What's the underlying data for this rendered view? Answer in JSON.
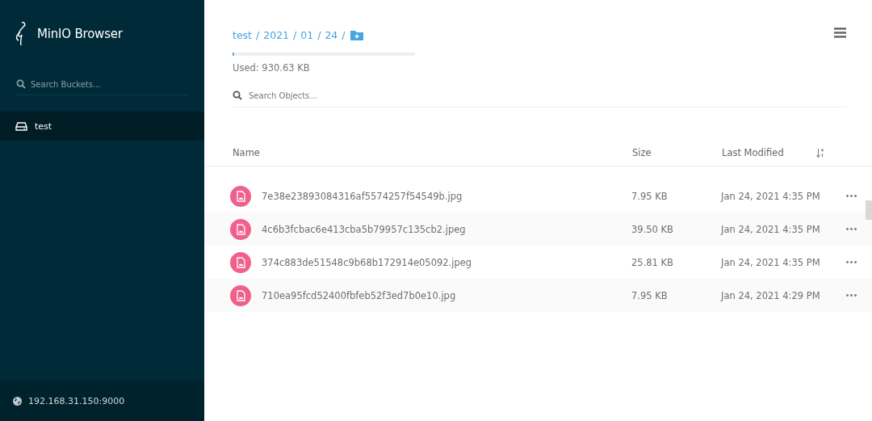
{
  "sidebar": {
    "app_name": "MinIO Browser",
    "search": {
      "placeholder": "Search Buckets..."
    },
    "buckets": [
      {
        "name": "test",
        "selected": true
      }
    ],
    "host": "192.168.31.150:9000"
  },
  "main": {
    "breadcrumb": [
      {
        "label": "test",
        "separator": "/"
      },
      {
        "label": "2021",
        "separator": "/"
      },
      {
        "label": "01",
        "separator": "/"
      },
      {
        "label": "24",
        "separator": "/"
      }
    ],
    "usage": {
      "level": 0.01,
      "label": "Used: 930.63 KB"
    },
    "search": {
      "placeholder": "Search Objects..."
    },
    "table": {
      "columns": [
        "Name",
        "Size",
        "Last Modified"
      ],
      "rows": [
        {
          "name": "7e38e23893084316af5574257f54549b.jpg",
          "size": "7.95 KB",
          "modified": "Jan 24, 2021 4:35 PM"
        },
        {
          "name": "4c6b3fcbac6e413cba5b79957c135cb2.jpeg",
          "size": "39.50 KB",
          "modified": "Jan 24, 2021 4:35 PM"
        },
        {
          "name": "374c883de51548c9b68b172914e05092.jpeg",
          "size": "25.81 KB",
          "modified": "Jan 24, 2021 4:35 PM"
        },
        {
          "name": "710ea95fcd52400fbfeb52f3ed7b0e10.jpg",
          "size": "7.95 KB",
          "modified": "Jan 24, 2021 4:29 PM"
        }
      ]
    }
  }
}
